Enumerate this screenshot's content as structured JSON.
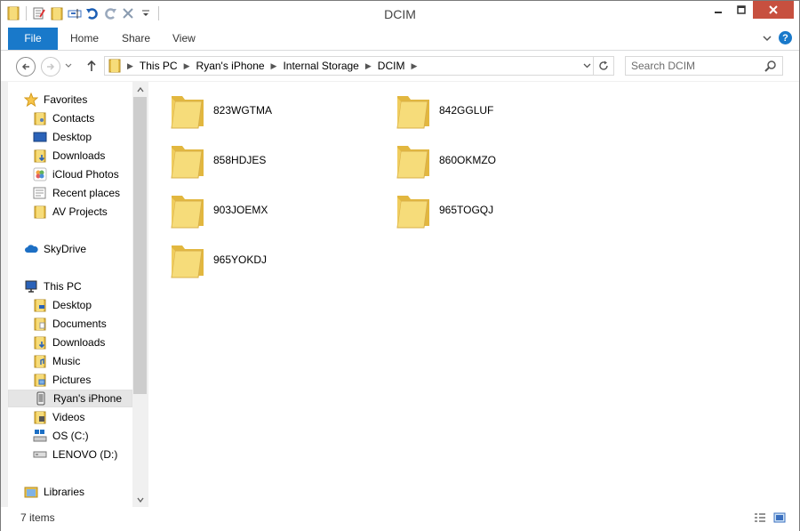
{
  "window": {
    "title": "DCIM"
  },
  "ribbon": {
    "tabs": [
      "File",
      "Home",
      "Share",
      "View"
    ]
  },
  "address": {
    "breadcrumbs": [
      "This PC",
      "Ryan's iPhone",
      "Internal Storage",
      "DCIM"
    ]
  },
  "search": {
    "placeholder": "Search DCIM"
  },
  "sidebar": {
    "favorites": {
      "label": "Favorites",
      "items": [
        {
          "label": "Contacts",
          "icon": "contacts-folder-icon"
        },
        {
          "label": "Desktop",
          "icon": "desktop-icon"
        },
        {
          "label": "Downloads",
          "icon": "downloads-folder-icon"
        },
        {
          "label": "iCloud Photos",
          "icon": "icloud-photos-icon"
        },
        {
          "label": "Recent places",
          "icon": "recent-places-icon"
        },
        {
          "label": "AV Projects",
          "icon": "folder-icon"
        }
      ]
    },
    "skydrive": {
      "label": "SkyDrive"
    },
    "thispc": {
      "label": "This PC",
      "items": [
        {
          "label": "Desktop",
          "icon": "desktop-folder-icon"
        },
        {
          "label": "Documents",
          "icon": "documents-folder-icon"
        },
        {
          "label": "Downloads",
          "icon": "downloads-folder-icon"
        },
        {
          "label": "Music",
          "icon": "music-folder-icon"
        },
        {
          "label": "Pictures",
          "icon": "pictures-folder-icon"
        },
        {
          "label": "Ryan's iPhone",
          "icon": "iphone-icon",
          "selected": true
        },
        {
          "label": "Videos",
          "icon": "videos-folder-icon"
        },
        {
          "label": "OS (C:)",
          "icon": "os-drive-icon"
        },
        {
          "label": "LENOVO (D:)",
          "icon": "drive-icon"
        }
      ]
    },
    "libraries": {
      "label": "Libraries"
    }
  },
  "main": {
    "folders": [
      "823WGTMA",
      "842GGLUF",
      "858HDJES",
      "860OKMZO",
      "903JOEMX",
      "965TOGQJ",
      "965YOKDJ"
    ]
  },
  "status": {
    "items_text": "7 items"
  },
  "colors": {
    "accent": "#1979ca",
    "close": "#c7503f",
    "folder": "#f3d678"
  }
}
